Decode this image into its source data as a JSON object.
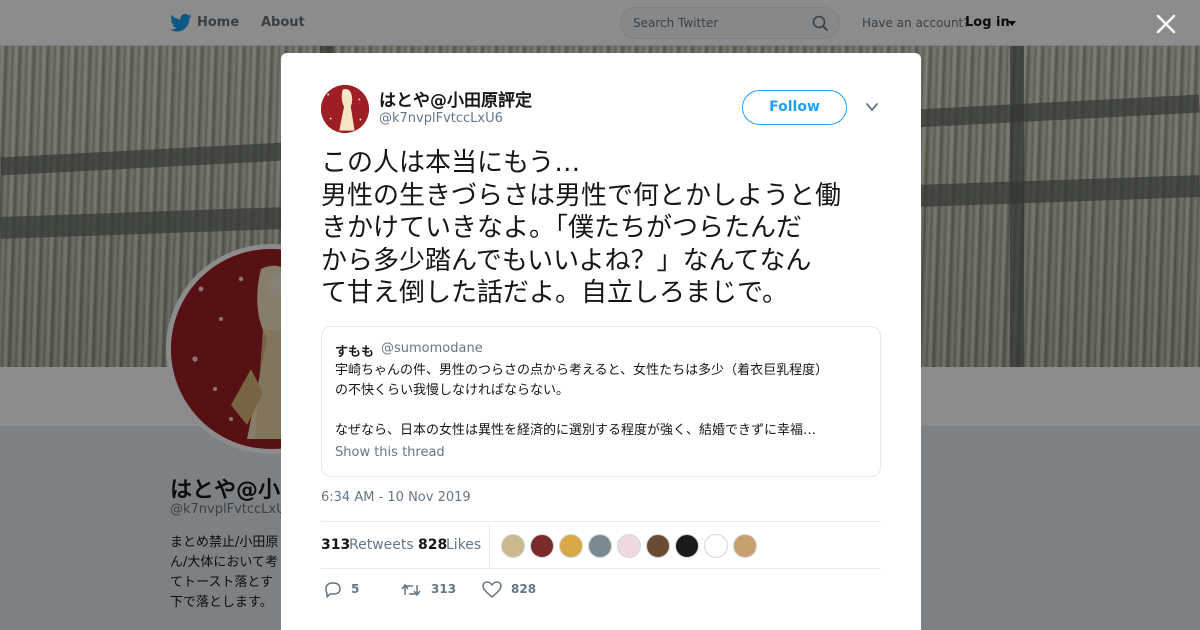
{
  "topbar": {
    "home_label": "Home",
    "about_label": "About",
    "search_placeholder": "Search Twitter",
    "account_prompt": "Have an account?",
    "login_label": "Log in"
  },
  "profile_background": {
    "name": "はとや@小田",
    "handle": "@k7nvplFvtccLxU",
    "bio_lines": [
      "まとめ禁止/小田原",
      "ん/大体において考",
      "てトースト落とす",
      "下で落とします。"
    ]
  },
  "tweet": {
    "author_name": "はとや@小田原評定",
    "author_handle": "@k7nvplFvtccLxU6",
    "follow_label": "Follow",
    "text_lines": [
      "この人は本当にもう…",
      "男性の生きづらさは男性で何とかしようと働",
      "きかけていきなよ。「僕たちがつらたんだ",
      "から多少踏んでもいいよね？」なんてなん",
      "て甘え倒した話だよ。自立しろまじで。"
    ],
    "quote": {
      "name": "すもも",
      "handle": "@sumomodane",
      "lines": [
        "宇崎ちゃんの件、男性のつらさの点から考えると、女性たちは多少（着衣巨乳程度）",
        "の不快くらい我慢しなければならない。",
        "",
        "なぜなら、日本の女性は異性を経済的に選別する程度が強く、結婚できずに幸福…"
      ],
      "show_thread": "Show this thread"
    },
    "timestamp": "6:34 AM - 10 Nov 2019",
    "retweets_count": "313",
    "retweets_label": "Retweets",
    "likes_count": "828",
    "likes_label": "Likes",
    "likers": [
      "#c9b98d",
      "#7a2a2a",
      "#d9a847",
      "#7a8a90",
      "#f0d8e0",
      "#6a4a30",
      "#1a1a1a",
      "#ffffff",
      "#c8a070"
    ],
    "actions": {
      "reply_count": "5",
      "retweet_count": "313",
      "like_count": "828"
    }
  },
  "colors": {
    "accent": "#1da1f2",
    "secondary_text": "#657786",
    "avatar_bg": "#9e1e25"
  }
}
